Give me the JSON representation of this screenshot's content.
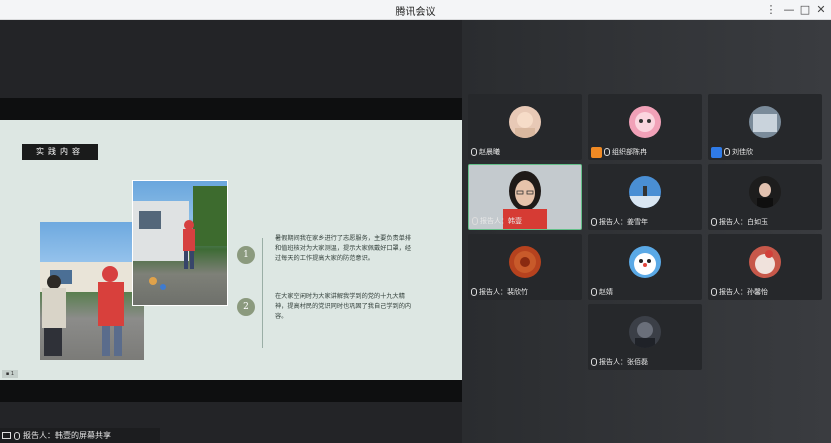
{
  "window": {
    "title": "腾讯会议"
  },
  "slide": {
    "title": "实践内容",
    "items": [
      {
        "num": "1",
        "text": "暑假期间我在家乡进行了志愿服务，主要负责单排和值班核对为大家测温，提示大家佩戴好口罩，经过每天的工作提高大家的防范意识。"
      },
      {
        "num": "2",
        "text": "在大家空闲时为大家讲解我学到的党的十九大精神，提高村民的党识同时也巩固了我自己学到的内容。"
      }
    ],
    "corner_label": "▪ 1"
  },
  "participants": [
    {
      "label": "赵晨曦",
      "prefix": "",
      "badge": "none",
      "avatar_color": "#e8c9b6"
    },
    {
      "label": "组织部陈冉",
      "prefix": "",
      "badge": "org",
      "avatar_color": "#f1a1b8"
    },
    {
      "label": "刘佳欣",
      "prefix": "",
      "badge": "blue",
      "avatar_color": "#7a8b9a"
    },
    {
      "label": "报告人：韩壹",
      "prefix": "",
      "badge": "none",
      "avatar_color": "",
      "video": true
    },
    {
      "label": "报告人：姜雪年",
      "prefix": "",
      "badge": "none",
      "avatar_color": "#4a8fd4"
    },
    {
      "label": "报告人：白如玉",
      "prefix": "",
      "badge": "none",
      "avatar_color": "#1d1d1d"
    },
    {
      "label": "报告人：裴欣竹",
      "prefix": "",
      "badge": "none",
      "avatar_color": "#b6421e"
    },
    {
      "label": "赵婧",
      "prefix": "",
      "badge": "none",
      "avatar_color": "#5aa9e6"
    },
    {
      "label": "报告人：孙馨怡",
      "prefix": "",
      "badge": "none",
      "avatar_color": "#c7584a"
    },
    {
      "label": "报告人：张佰磊",
      "prefix": "",
      "badge": "none",
      "avatar_color": "#3b3f47"
    }
  ],
  "statusbar": {
    "text": "报告人：韩壹的屏幕共享"
  }
}
